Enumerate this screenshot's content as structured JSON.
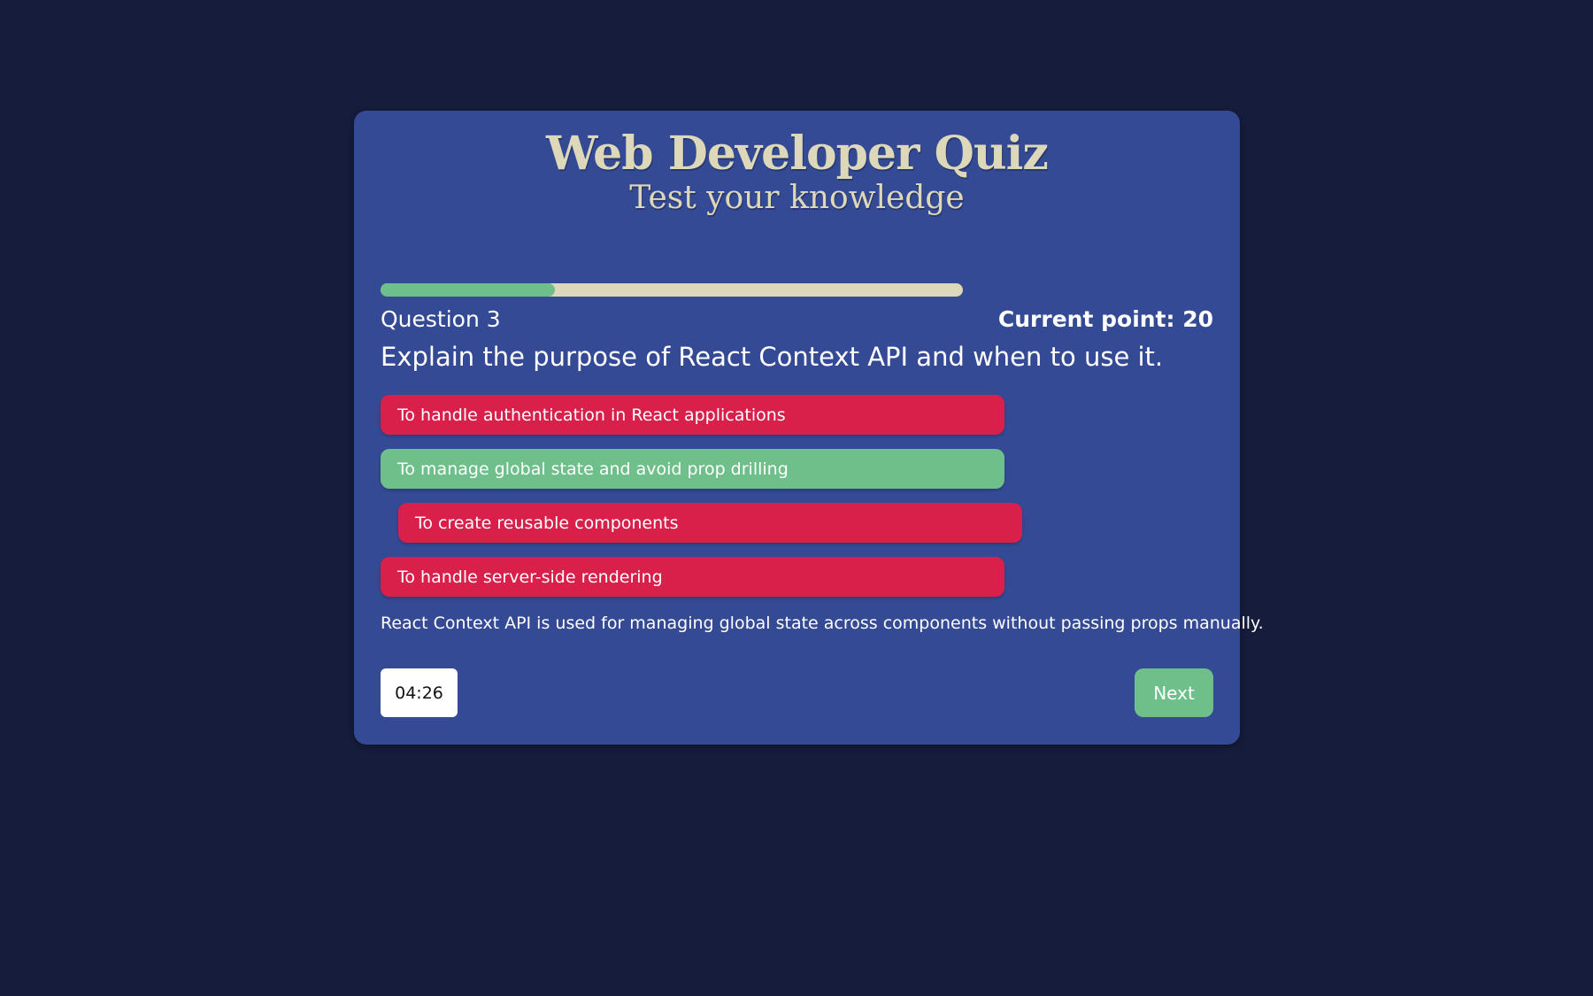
{
  "header": {
    "title": "Web Developer Quiz",
    "subtitle": "Test your knowledge"
  },
  "progress": {
    "fraction": 0.3
  },
  "question": {
    "number_label": "Question 3",
    "points_label": "Current point: 20",
    "text": "Explain the purpose of React Context API and when to use it."
  },
  "options": [
    {
      "label": "To handle authentication in React applications",
      "state": "wrong"
    },
    {
      "label": "To manage global state and avoid prop drilling",
      "state": "correct"
    },
    {
      "label": "To create reusable components",
      "state": "wrong"
    },
    {
      "label": "To handle server-side rendering",
      "state": "wrong"
    }
  ],
  "explanation": "React Context API is used for managing global state across components without passing props manually.",
  "footer": {
    "timer": "04:26",
    "next_label": "Next"
  },
  "colors": {
    "background": "#161c3b",
    "card": "#354a95",
    "title": "#dcd8b9",
    "correct": "#6fbf8a",
    "wrong": "#d8204a",
    "progress_track": "#dcd8b9",
    "progress_fill": "#6fbf8a"
  }
}
